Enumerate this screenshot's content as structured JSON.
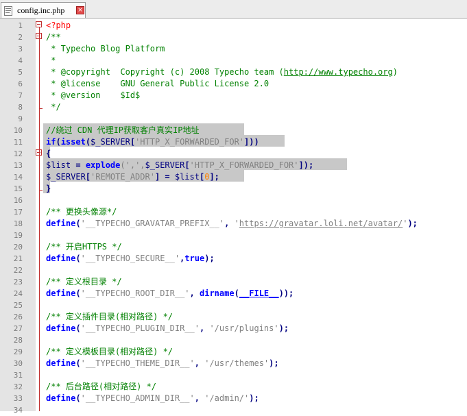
{
  "tab": {
    "filename": "config.inc.php",
    "close_icon": "close-icon",
    "file_icon": "php-file-icon"
  },
  "line_numbers": [
    "1",
    "2",
    "3",
    "4",
    "5",
    "6",
    "7",
    "8",
    "9",
    "10",
    "11",
    "12",
    "13",
    "14",
    "15",
    "16",
    "17",
    "18",
    "19",
    "20",
    "21",
    "22",
    "23",
    "24",
    "25",
    "26",
    "27",
    "28",
    "29",
    "30",
    "31",
    "32",
    "33",
    "34"
  ],
  "code": {
    "l1": "<?php",
    "l2": "/**",
    "l3": " * Typecho Blog Platform",
    "l4": " *",
    "l5a": " * @copyright  Copyright (c) 2008 Typecho team (",
    "l5b": "http://www.typecho.org",
    "l5c": ")",
    "l6": " * @license    GNU General Public License 2.0",
    "l7": " * @version    $Id$",
    "l8": " */",
    "l10": "//绕过 CDN 代理IP获取客户真实IP地址",
    "l11": [
      "if",
      "(",
      "isset",
      "(",
      "$_SERVER",
      "[",
      "'HTTP_X_FORWARDED_FOR'",
      "]))"
    ],
    "l12": "{",
    "l13": [
      "$list",
      " = ",
      "explode",
      "(',',",
      "$_SERVER",
      "[",
      "'HTTP_X_FORWARDED_FOR'",
      "]);"
    ],
    "l14": [
      "$_SERVER",
      "[",
      "'REMOTE_ADDR'",
      "] = ",
      "$list",
      "[",
      "0",
      "];"
    ],
    "l15": "}",
    "l17": "/** 更换头像源*/",
    "l18": [
      "define",
      "(",
      "'__TYPECHO_GRAVATAR_PREFIX__'",
      ", ",
      "'",
      "https://gravatar.loli.net/avatar/",
      "'",
      ");"
    ],
    "l20": "/** 开启HTTPS */",
    "l21": [
      "define",
      "(",
      "'__TYPECHO_SECURE__'",
      ",",
      "true",
      ");"
    ],
    "l23": "/** 定义根目录 */",
    "l24": [
      "define",
      "(",
      "'__TYPECHO_ROOT_DIR__'",
      ", ",
      "dirname",
      "(",
      "__FILE__",
      "));"
    ],
    "l26": "/** 定义插件目录(相对路径) */",
    "l27": [
      "define",
      "(",
      "'__TYPECHO_PLUGIN_DIR__'",
      ", ",
      "'/usr/plugins'",
      ");"
    ],
    "l29": "/** 定义模板目录(相对路径) */",
    "l30": [
      "define",
      "(",
      "'__TYPECHO_THEME_DIR__'",
      ", ",
      "'/usr/themes'",
      ");"
    ],
    "l32": "/** 后台路径(相对路径) */",
    "l33": [
      "define",
      "(",
      "'__TYPECHO_ADMIN_DIR__'",
      ", ",
      "'/admin/'",
      ");"
    ]
  },
  "colors": {
    "comment": "#008000",
    "keyword": "#0000ff",
    "string": "#808080",
    "selection": "#c8c8c8",
    "gutter": "#e4e4e4"
  }
}
